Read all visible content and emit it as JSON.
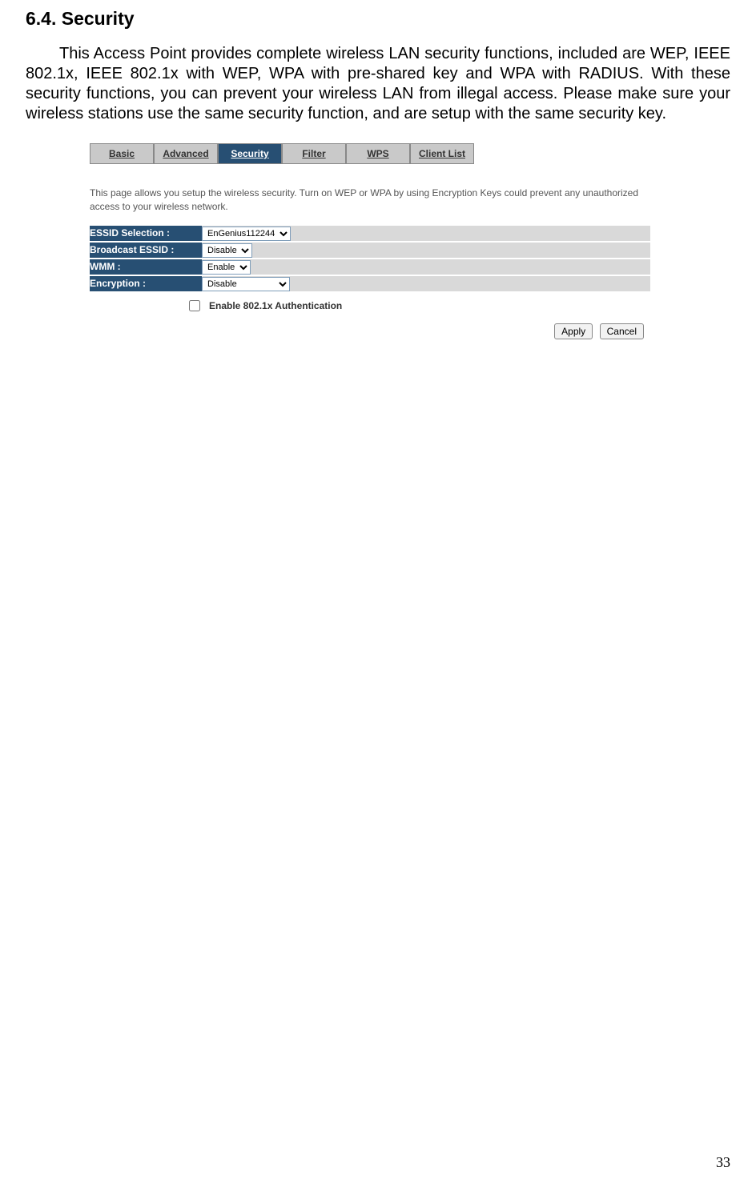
{
  "heading": "6.4. Security",
  "intro": "This Access Point provides complete wireless LAN security functions, included are WEP, IEEE 802.1x, IEEE 802.1x with WEP, WPA with pre-shared key and WPA with RADIUS. With these security functions, you can prevent your wireless LAN from illegal access. Please make sure your wireless stations use the same security function, and are setup with the same security key.",
  "tabs": {
    "basic": "Basic",
    "advanced": "Advanced",
    "security": "Security",
    "filter": "Filter",
    "wps": "WPS",
    "client_list": "Client List"
  },
  "description": "This page allows you setup the wireless security. Turn on WEP or WPA by using Encryption Keys could prevent any unauthorized access to your wireless network.",
  "form": {
    "essid_label": "ESSID Selection :",
    "essid_value": "EnGenius112244",
    "broadcast_label": "Broadcast ESSID :",
    "broadcast_value": "Disable",
    "wmm_label": "WMM :",
    "wmm_value": "Enable",
    "encryption_label": "Encryption :",
    "encryption_value": "Disable"
  },
  "enable_8021x_label": "Enable 802.1x Authentication",
  "buttons": {
    "apply": "Apply",
    "cancel": "Cancel"
  },
  "page_number": "33"
}
